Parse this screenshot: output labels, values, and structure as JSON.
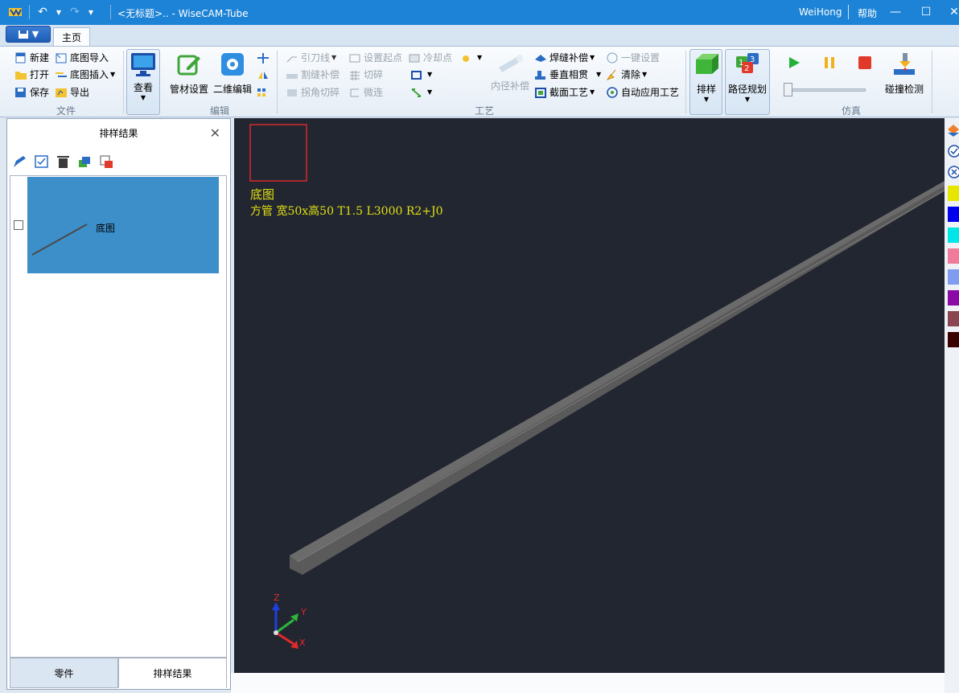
{
  "app": {
    "title": "<无标题>.. - WiseCAM-Tube",
    "user": "WeiHong",
    "help": "帮助",
    "tab_home": "主页"
  },
  "colors": {
    "titlebar": "#1d83d6",
    "canvas_bg": "#222631",
    "part_fill": "#3d8fc9",
    "annotation": "#e0e010",
    "frame": "#d42a2a"
  },
  "ribbon": {
    "file": {
      "label": "文件",
      "new": "新建",
      "open": "打开",
      "save": "保存",
      "import_base": "底图导入",
      "insert_base": "底图插入",
      "export": "导出"
    },
    "view": {
      "label": "查看"
    },
    "edit": {
      "label": "编辑",
      "tube_settings": "管材设置",
      "edit2d": "二维编辑"
    },
    "process": {
      "label": "工艺",
      "lead_line": "引刀线",
      "set_start": "设置起点",
      "cool_point": "冷却点",
      "kerf_comp": "割缝补偿",
      "cut_break": "切碎",
      "corner_cut": "拐角切碎",
      "micro_joint": "微连",
      "inner_comp": "内径补偿",
      "weld_comp": "焊缝补偿",
      "one_key": "一键设置",
      "vertical_join": "垂直相贯",
      "clear": "清除",
      "section_proc": "截面工艺",
      "auto_apply": "自动应用工艺"
    },
    "nest": {
      "label": "排样"
    },
    "path": {
      "label": "路径规划"
    },
    "sim": {
      "label": "仿真",
      "collision": "碰撞检测"
    }
  },
  "left_panel": {
    "title": "排样结果",
    "items": [
      {
        "label": "底图"
      }
    ],
    "tab_parts": "零件",
    "tab_nest": "排样结果"
  },
  "canvas": {
    "anno_title": "底图",
    "anno_spec": "方管 宽50x高50 T1.5 L3000 R2+J0",
    "axis": {
      "z": "Z",
      "y": "Y",
      "x": "X"
    }
  },
  "palette": [
    "#e6e600",
    "#0000ee",
    "#00e6e6",
    "#f07a9a",
    "#7f9cf0",
    "#8a0aa6",
    "#8b4550",
    "#3a0000"
  ]
}
